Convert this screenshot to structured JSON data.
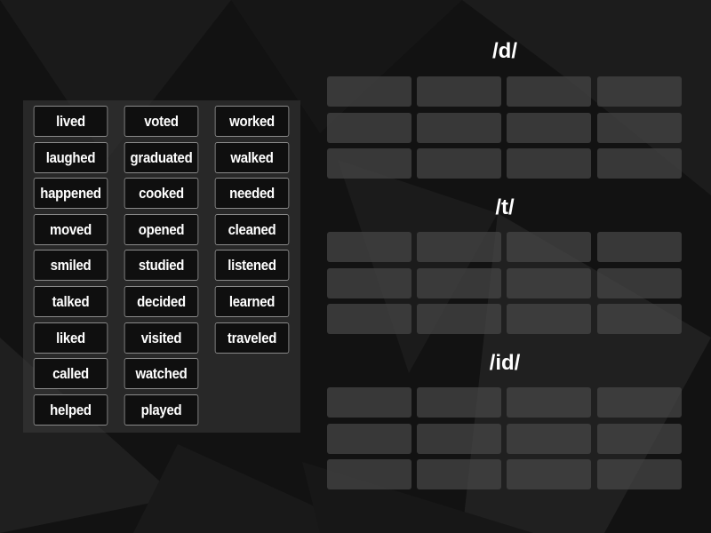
{
  "word_bank": {
    "columns": [
      [
        "lived",
        "laughed",
        "happened",
        "moved",
        "smiled",
        "talked",
        "liked",
        "called",
        "helped"
      ],
      [
        "voted",
        "graduated",
        "cooked",
        "opened",
        "studied",
        "decided",
        "visited",
        "watched",
        "played"
      ],
      [
        "worked",
        "walked",
        "needed",
        "cleaned",
        "listened",
        "learned",
        "traveled"
      ]
    ]
  },
  "groups": [
    {
      "title": "/d/",
      "slot_rows": 3,
      "slot_cols": 4
    },
    {
      "title": "/t/",
      "slot_rows": 3,
      "slot_cols": 4
    },
    {
      "title": "/id/",
      "slot_rows": 3,
      "slot_cols": 4
    }
  ]
}
